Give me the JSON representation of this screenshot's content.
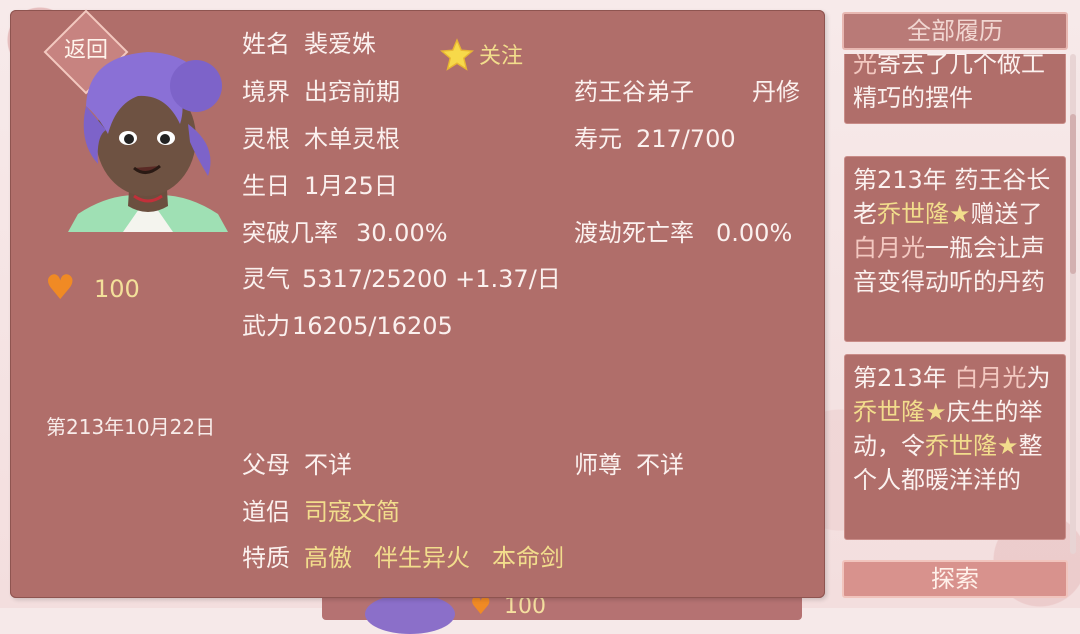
{
  "nav": {
    "back_label": "返回"
  },
  "character": {
    "name_label": "姓名",
    "name": "裴爱姝",
    "follow_label": "关注",
    "realm_label": "境界",
    "realm": "出窍前期",
    "sect": "药王谷弟子",
    "cultivation_type": "丹修",
    "root_label": "灵根",
    "root": "木单灵根",
    "lifespan_label": "寿元",
    "lifespan": "217/700",
    "birthday_label": "生日",
    "birthday": "1月25日",
    "breakthrough_label": "突破几率",
    "breakthrough": "30.00%",
    "tribulation_label": "渡劫死亡率",
    "tribulation": "0.00%",
    "qi_label": "灵气",
    "qi": "5317/25200 +1.37/日",
    "power_label": "武力",
    "power": "16205/16205",
    "favor": "100",
    "date": "第213年10月22日",
    "parents_label": "父母",
    "parents": "不详",
    "master_label": "师尊",
    "master": "不详",
    "partner_label": "道侣",
    "partner": "司寇文简",
    "traits_label": "特质",
    "traits": [
      "高傲",
      "伴生异火",
      "本命剑"
    ]
  },
  "side": {
    "history_button": "全部履历",
    "explore_button": "探索",
    "logs": [
      {
        "parts": [
          [
            "光",
            "p"
          ],
          [
            "寄去了几个做工精巧的摆件",
            "n"
          ]
        ]
      },
      {
        "parts": [
          [
            "第213年 药王谷长老",
            "n"
          ],
          [
            "乔世隆★",
            "y"
          ],
          [
            "赠送了",
            "n"
          ],
          [
            "白月光",
            "p"
          ],
          [
            "一瓶会让声音变得动听的丹药",
            "n"
          ]
        ]
      },
      {
        "parts": [
          [
            "第213年 ",
            "n"
          ],
          [
            "白月光",
            "p"
          ],
          [
            "为",
            "n"
          ],
          [
            "乔世隆★",
            "y"
          ],
          [
            "庆生的举动，令",
            "n"
          ],
          [
            "乔世隆★",
            "y"
          ],
          [
            "整个人都暖洋洋的",
            "n"
          ]
        ]
      }
    ]
  },
  "peek": {
    "favor": "100"
  },
  "colors": {
    "panel": "#b06e6a",
    "highlight": "#f2dd8c",
    "accent_pink": "#f3c8c0",
    "heart": "#f08a24"
  }
}
